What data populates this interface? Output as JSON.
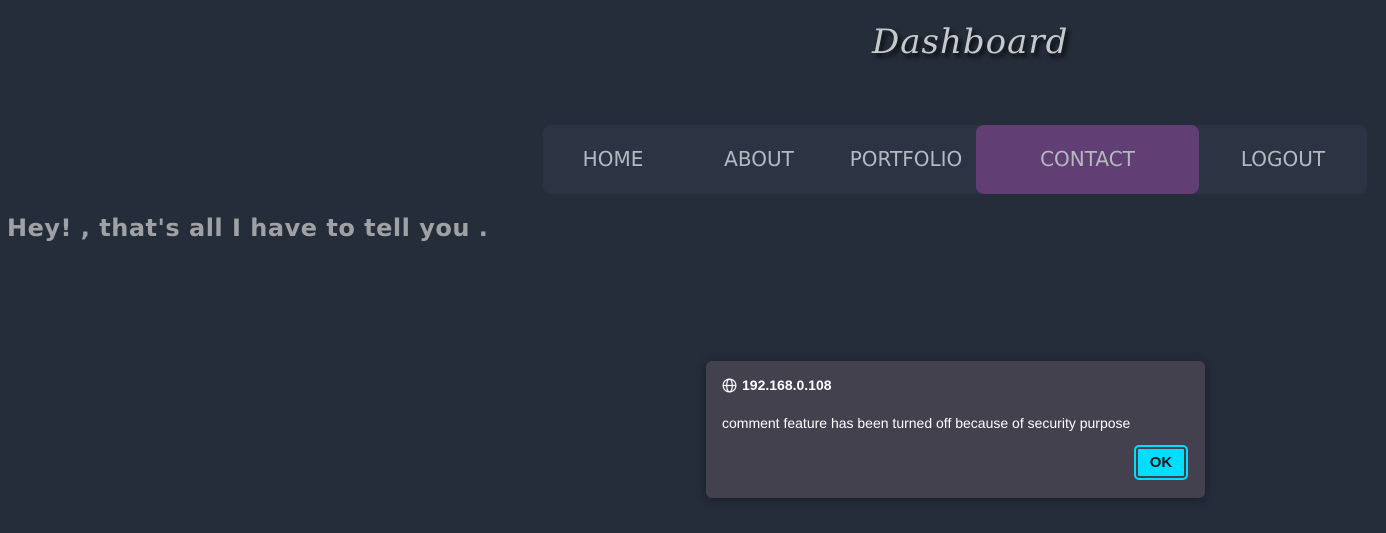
{
  "header": {
    "title": "Dashboard"
  },
  "nav": {
    "items": [
      {
        "label": "HOME",
        "active": false
      },
      {
        "label": "ABOUT",
        "active": false
      },
      {
        "label": "PORTFOLIO",
        "active": false
      },
      {
        "label": "CONTACT",
        "active": true
      },
      {
        "label": "LOGOUT",
        "active": false
      }
    ]
  },
  "main": {
    "message": "Hey! , that's all I have to tell you ."
  },
  "dialog": {
    "origin": "192.168.0.108",
    "origin_icon": "globe-icon",
    "text": "comment feature has been turned off because of security purpose",
    "ok_label": "OK"
  },
  "colors": {
    "background": "#252d3a",
    "nav_background": "#2c3444",
    "nav_active": "#613f75",
    "dialog_background": "#42414d",
    "dialog_button": "#00ddff"
  }
}
